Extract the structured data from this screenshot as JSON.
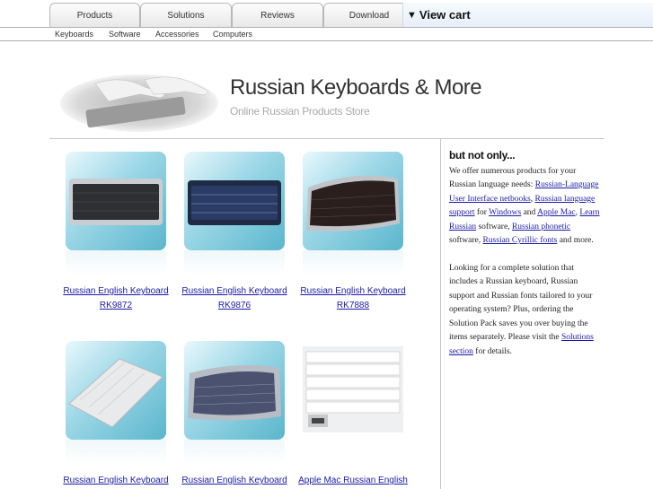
{
  "nav": {
    "tabs": [
      "Products",
      "Solutions",
      "Reviews",
      "Download"
    ],
    "view_cart": "View cart",
    "sub_items": [
      "Keyboards",
      "Software",
      "Accessories",
      "Computers"
    ]
  },
  "header": {
    "title": "Russian Keyboards & More",
    "subtitle": "Online Russian Products Store"
  },
  "products": [
    {
      "name_line1": "Russian English Keyboard",
      "name_line2": "RK9872"
    },
    {
      "name_line1": "Russian English Keyboard",
      "name_line2": "RK9876"
    },
    {
      "name_line1": "Russian English Keyboard",
      "name_line2": "RK7888"
    },
    {
      "name_line1": "Russian English Keyboard",
      "name_line2": ""
    },
    {
      "name_line1": "Russian English Keyboard",
      "name_line2": ""
    },
    {
      "name_line1": "Apple Mac Russian English",
      "name_line2": ""
    }
  ],
  "sidebar": {
    "heading": "but not only...",
    "p1_intro": "We offer numerous products for your Russian language needs: ",
    "link_ui": "Russian-Language User Interface netbooks",
    "sep1": ", ",
    "link_support": "Russian language support",
    "for_text": " for ",
    "link_windows": "Windows",
    "and_text": " and ",
    "link_mac": "Apple Mac",
    "sep2": ", ",
    "link_learn": "Learn Russian",
    "software_text": " software, ",
    "link_phonetic": "Russian phonetic",
    "software_text2": " software, ",
    "link_fonts": "Russian Cyrillic fonts",
    "more_text": " and more.",
    "p2_text": "Looking for a complete solution that includes a Russian keyboard, Russian support and Russian fonts tailored to your operating system? Plus, ordering the Solution Pack saves you over buying the items separately. Please visit the ",
    "link_solutions": "Solutions section",
    "p2_end": " for details."
  }
}
